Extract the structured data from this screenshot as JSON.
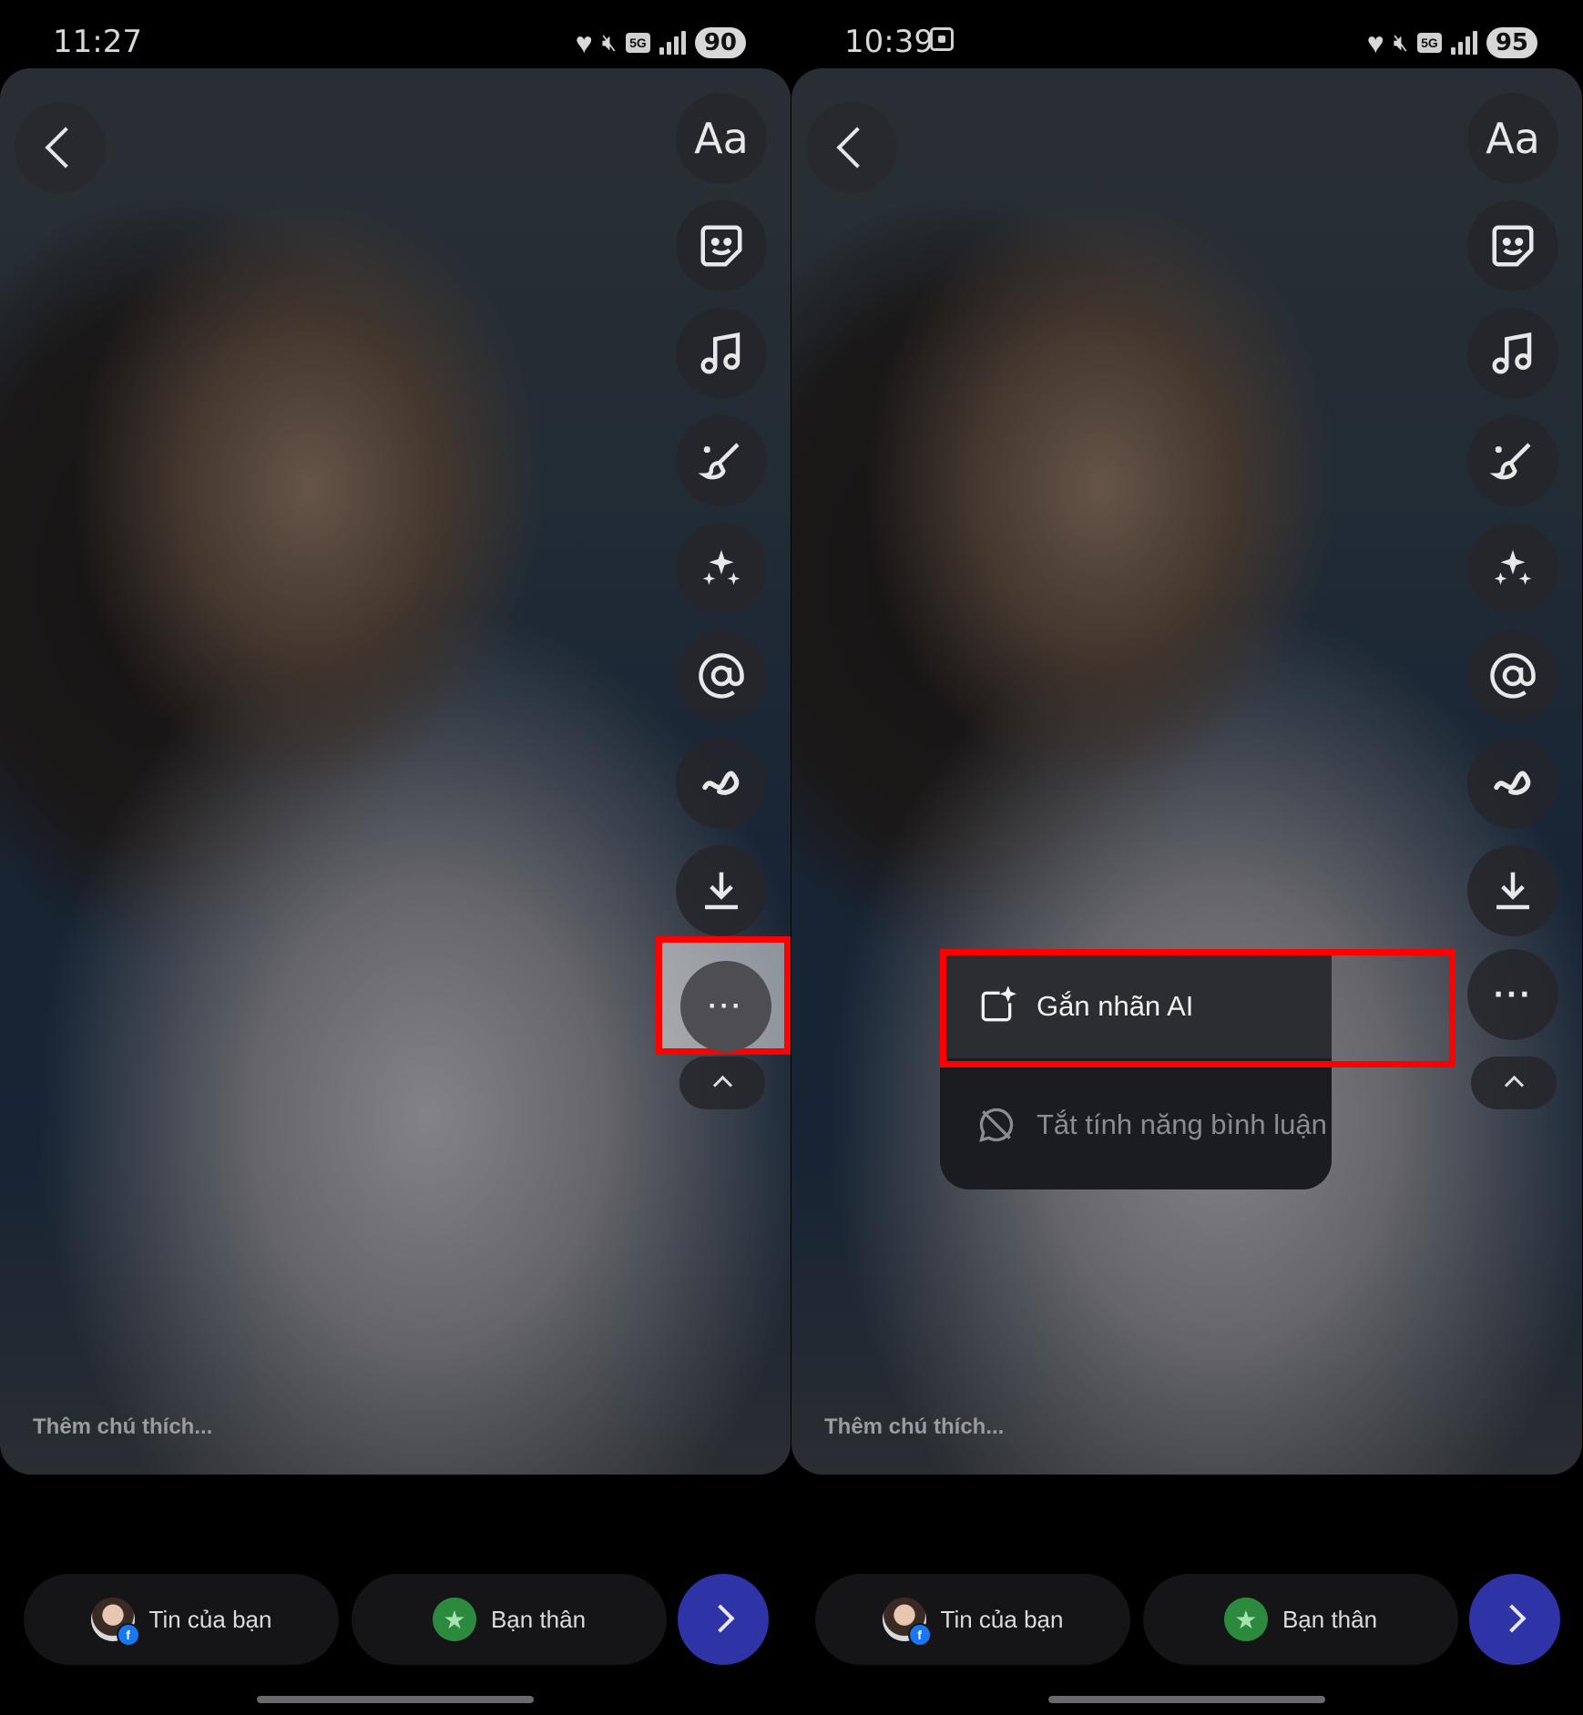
{
  "left": {
    "status": {
      "time": "11:27",
      "battery": "90",
      "network": "5G"
    },
    "caption_placeholder": "Thêm chú thích...",
    "tools": [
      {
        "icon": "text-icon",
        "label": "Aa"
      },
      {
        "icon": "sticker-icon"
      },
      {
        "icon": "music-icon"
      },
      {
        "icon": "draw-icon"
      },
      {
        "icon": "effects-icon"
      },
      {
        "icon": "mention-icon"
      },
      {
        "icon": "squiggle-icon"
      },
      {
        "icon": "download-icon"
      },
      {
        "icon": "more-icon",
        "label": "···"
      }
    ],
    "share": {
      "your_story": "Tin của bạn",
      "close_friends": "Bạn thân"
    }
  },
  "right": {
    "status": {
      "time": "10:39",
      "battery": "95",
      "network": "5G"
    },
    "caption_placeholder": "Thêm chú thích...",
    "tools": [
      {
        "icon": "text-icon",
        "label": "Aa"
      },
      {
        "icon": "sticker-icon"
      },
      {
        "icon": "music-icon"
      },
      {
        "icon": "draw-icon"
      },
      {
        "icon": "effects-icon"
      },
      {
        "icon": "mention-icon"
      },
      {
        "icon": "squiggle-icon"
      },
      {
        "icon": "download-icon"
      },
      {
        "icon": "more-icon",
        "label": "···"
      }
    ],
    "menu": {
      "ai_label": "Gắn nhãn AI",
      "disable_comments": "Tắt tính năng bình luận"
    },
    "share": {
      "your_story": "Tin của bạn",
      "close_friends": "Bạn thân"
    }
  },
  "colors": {
    "highlight": "#ff0000",
    "next_button": "#2e34a5",
    "close_friends_badge": "#2b8a3e"
  }
}
